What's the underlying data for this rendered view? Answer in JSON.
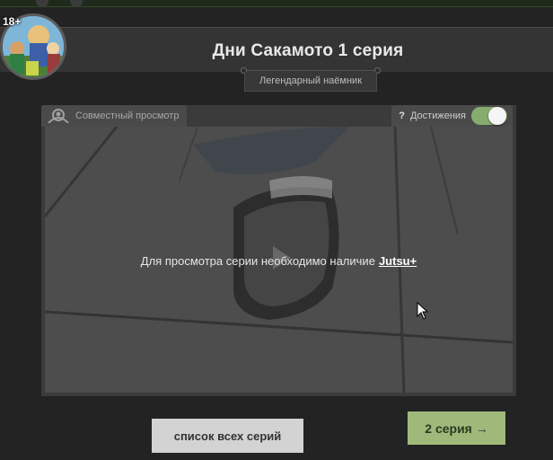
{
  "header": {
    "age_rating": "18+",
    "title": "Дни Сакамото 1 серия",
    "subtitle": "Легендарный наёмник"
  },
  "player": {
    "watch_together_label": "Совместный просмотр",
    "help_symbol": "?",
    "achievements_label": "Достижения",
    "achievements_toggle_on": true,
    "message_text": "Для просмотра серии необходимо наличие",
    "message_link": "Jutsu+"
  },
  "navigation": {
    "all_episodes_label": "список всех серий",
    "next_episode_label": "2 серия →"
  },
  "colors": {
    "accent_green": "#9fb97a",
    "toggle_green": "#86ac6e",
    "background": "#232323"
  }
}
